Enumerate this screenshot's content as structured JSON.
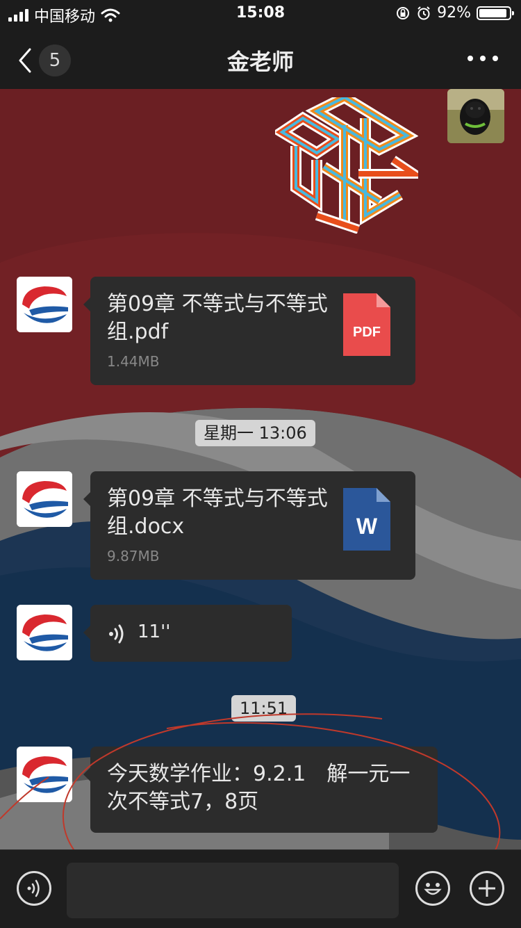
{
  "status_bar": {
    "carrier": "中国移动",
    "time": "15:08",
    "battery": "92%",
    "battery_level": 0.92,
    "icons": [
      "signal-icon",
      "wifi-icon",
      "orientation-lock-icon",
      "alarm-icon",
      "battery-icon"
    ]
  },
  "nav": {
    "title": "金老师",
    "unread_count": "5",
    "icons": [
      "back-chevron-icon",
      "more-dots-icon"
    ]
  },
  "messages": [
    {
      "type": "file",
      "name": "第09章 不等式与不等式组.pdf",
      "size": "1.44MB",
      "file_type": "PDF",
      "icon_color": "#e94c4c"
    },
    {
      "type": "timestamp",
      "text": "星期一 13:06"
    },
    {
      "type": "file",
      "name": "第09章 不等式与不等式组.docx",
      "size": "9.87MB",
      "file_type": "W",
      "icon_color": "#2b579a"
    },
    {
      "type": "voice",
      "duration": "11''"
    },
    {
      "type": "timestamp",
      "text": "11:51"
    },
    {
      "type": "text",
      "text": "今天数学作业：9.2.1　解一元一次不等式7，8页"
    }
  ],
  "input_bar": {
    "icons": [
      "voice-mode-icon",
      "emoji-icon",
      "plus-icon"
    ],
    "placeholder": ""
  },
  "colors": {
    "bar_bg": "#1c1c1c",
    "bubble_bg": "#2c2c2c",
    "annotation_red": "#c0392b"
  }
}
